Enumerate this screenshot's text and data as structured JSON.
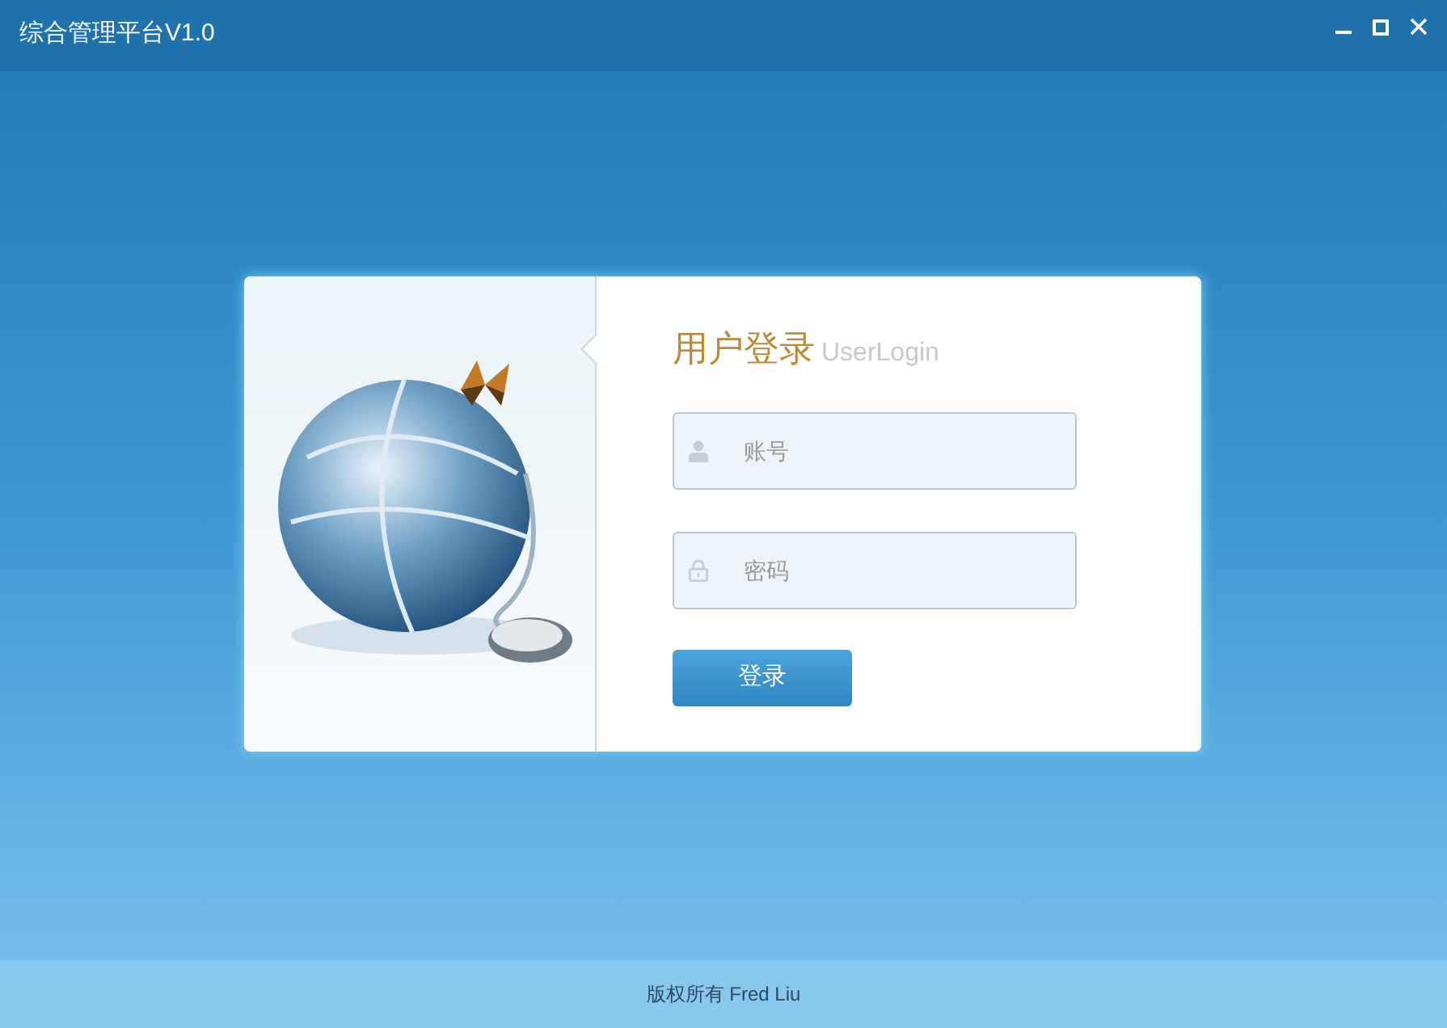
{
  "window": {
    "title": "综合管理平台V1.0"
  },
  "login": {
    "title": "用户登录",
    "subtitle": "UserLogin",
    "fields": [
      {
        "kind": "user",
        "placeholder": "账号"
      },
      {
        "kind": "password",
        "placeholder": "密码"
      }
    ],
    "button": "登录"
  },
  "status_bar": {
    "copyright": "版权所有 Fred Liu"
  }
}
